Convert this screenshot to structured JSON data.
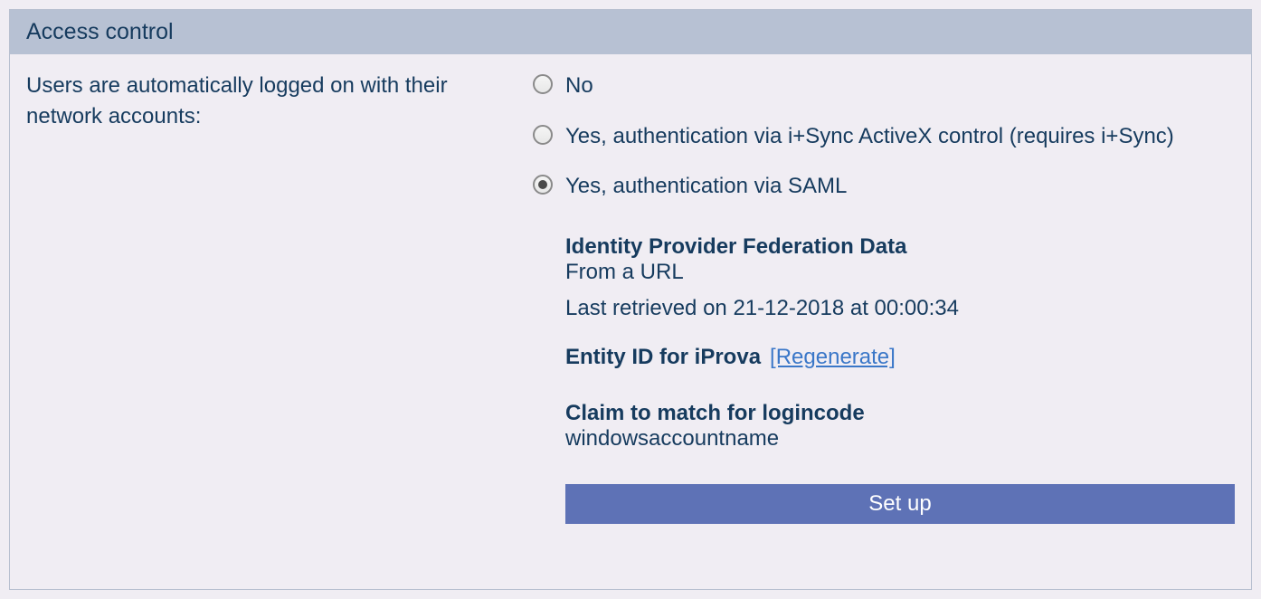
{
  "header": {
    "title": "Access control"
  },
  "setting": {
    "label": "Users are automatically logged on with their network accounts:"
  },
  "radios": {
    "no": "No",
    "activex": "Yes, authentication via i+Sync ActiveX control (requires i+Sync)",
    "saml": "Yes, authentication via SAML"
  },
  "saml": {
    "idp_heading": "Identity Provider Federation Data",
    "idp_source": "From a URL",
    "last_retrieved": "Last retrieved on 21-12-2018 at 00:00:34",
    "entity_heading": "Entity ID for iProva",
    "regenerate": "[Regenerate]",
    "claim_heading": "Claim to match for logincode",
    "claim_value": "windowsaccountname",
    "setup_button": "Set up"
  }
}
